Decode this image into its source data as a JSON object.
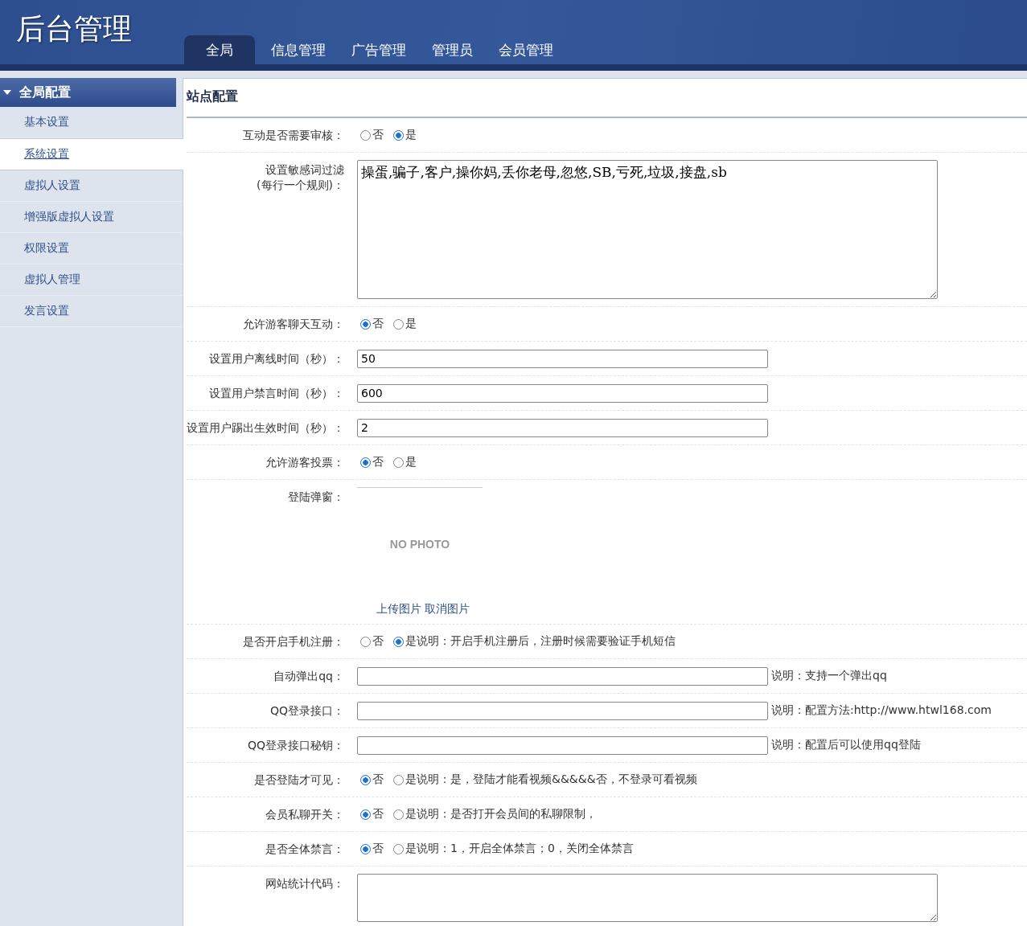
{
  "header": {
    "title": "后台管理",
    "tabs": [
      {
        "label": "全局",
        "selected": true
      },
      {
        "label": "信息管理",
        "selected": false
      },
      {
        "label": "广告管理",
        "selected": false
      },
      {
        "label": "管理员",
        "selected": false
      },
      {
        "label": "会员管理",
        "selected": false
      }
    ]
  },
  "sidebar": {
    "section": {
      "title": "全局配置",
      "expanded": true
    },
    "items": [
      {
        "label": "基本设置",
        "selected": false
      },
      {
        "label": "系统设置",
        "selected": true
      },
      {
        "label": "虚拟人设置",
        "selected": false
      },
      {
        "label": "增强版虚拟人设置",
        "selected": false
      },
      {
        "label": "权限设置",
        "selected": false
      },
      {
        "label": "虚拟人管理",
        "selected": false
      },
      {
        "label": "发言设置",
        "selected": false
      }
    ]
  },
  "panel": {
    "title": "站点配置",
    "rows": [
      {
        "kind": "radio",
        "label": "互动是否需要审核：",
        "options": [
          {
            "label": "否",
            "selected": false
          },
          {
            "label": "是",
            "selected": true
          }
        ]
      },
      {
        "kind": "textarea",
        "label": "设置敏感词过滤",
        "sublabel": "(每行一个规则)：",
        "value": "操蛋,骗子,客户,操你妈,丢你老母,忽悠,SB,亏死,垃圾,接盘,sb"
      },
      {
        "kind": "radio",
        "label": "允许游客聊天互动：",
        "options": [
          {
            "label": "否",
            "selected": true
          },
          {
            "label": "是",
            "selected": false
          }
        ]
      },
      {
        "kind": "text",
        "label": "设置用户离线时间（秒）：",
        "value": "50"
      },
      {
        "kind": "text",
        "label": "设置用户禁言时间（秒）：",
        "value": "600"
      },
      {
        "kind": "text",
        "label": "设置用户踢出生效时间（秒）：",
        "value": "2"
      },
      {
        "kind": "radio",
        "label": "允许游客投票：",
        "options": [
          {
            "label": "否",
            "selected": true
          },
          {
            "label": "是",
            "selected": false
          }
        ]
      },
      {
        "kind": "image",
        "label": "登陆弹窗：",
        "placeholder": "NO PHOTO",
        "links": [
          "上传图片",
          "取消图片"
        ]
      },
      {
        "kind": "radio",
        "label": "是否开启手机注册：",
        "options": [
          {
            "label": "否",
            "selected": false
          },
          {
            "label": "是",
            "selected": true
          }
        ],
        "note": "说明：开启手机注册后，注册时候需要验证手机短信"
      },
      {
        "kind": "text",
        "label": "自动弹出qq：",
        "note": "说明：支持一个弹出qq"
      },
      {
        "kind": "text",
        "label": "QQ登录接口：",
        "note": "说明：配置方法:http://www.htwl168.com"
      },
      {
        "kind": "text",
        "label": "QQ登录接口秘钥：",
        "note": "说明：配置后可以使用qq登陆"
      },
      {
        "kind": "radio",
        "label": "是否登陆才可见：",
        "options": [
          {
            "label": "否",
            "selected": true
          },
          {
            "label": "是",
            "selected": false
          }
        ],
        "note": "说明：是，登陆才能看视频&&&&&否，不登录可看视频"
      },
      {
        "kind": "radio",
        "label": "会员私聊开关：",
        "options": [
          {
            "label": "否",
            "selected": true
          },
          {
            "label": "是",
            "selected": false
          }
        ],
        "note": "说明：是否打开会员间的私聊限制，"
      },
      {
        "kind": "radio",
        "label": "是否全体禁言：",
        "options": [
          {
            "label": "否",
            "selected": true
          },
          {
            "label": "是",
            "selected": false
          }
        ],
        "note": "说明：1，开启全体禁言；0，关闭全体禁言"
      },
      {
        "kind": "codearea",
        "label": "网站统计代码："
      }
    ]
  }
}
